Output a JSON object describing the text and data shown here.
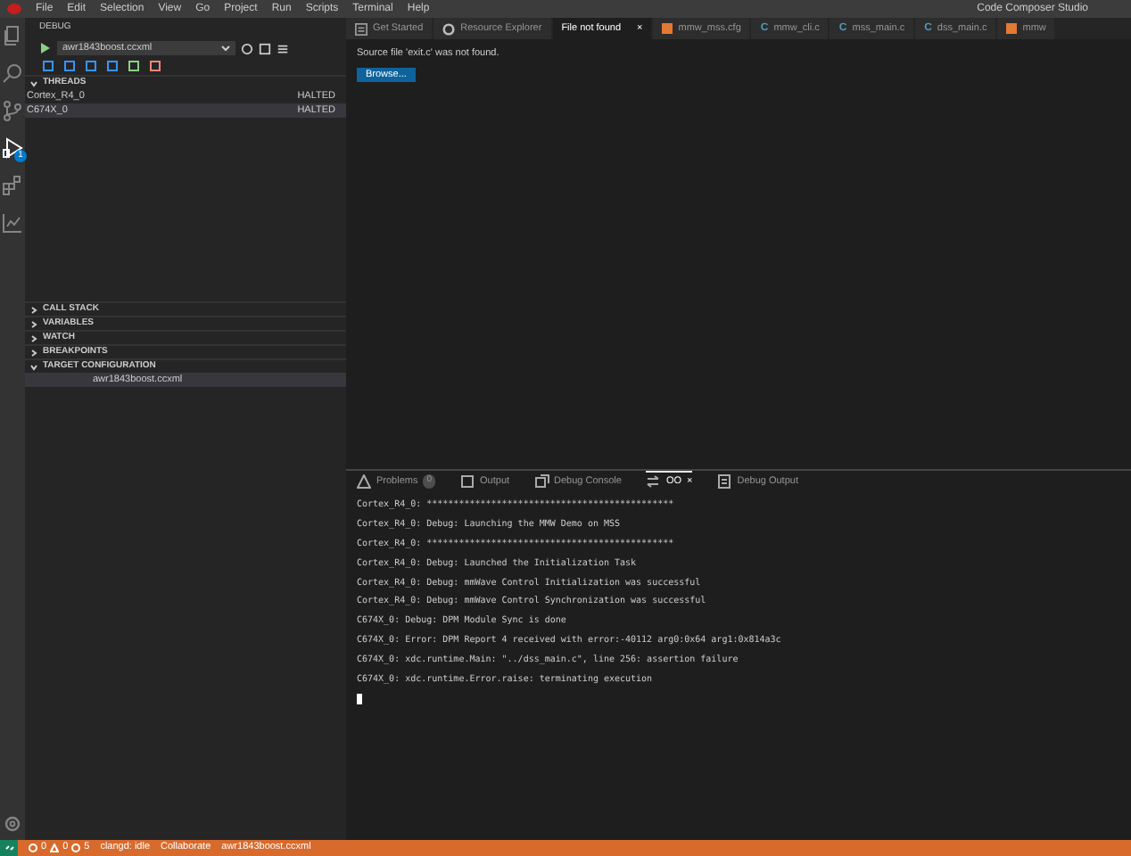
{
  "menu": [
    "File",
    "Edit",
    "Selection",
    "View",
    "Go",
    "Project",
    "Run",
    "Scripts",
    "Terminal",
    "Help"
  ],
  "window": {
    "title": "Code Composer Studio"
  },
  "activity_bar": [
    {
      "kind": "files",
      "selected": false
    },
    {
      "kind": "search",
      "selected": false
    },
    {
      "kind": "source",
      "selected": false
    },
    {
      "kind": "debug",
      "selected": true,
      "badge": "1"
    },
    {
      "kind": "extensions",
      "selected": false
    },
    {
      "kind": "chart",
      "selected": false
    }
  ],
  "sidebar": {
    "title": "DEBUG",
    "config": "awr1843boost.ccxml",
    "sections": [
      {
        "title": "THREADS",
        "expanded": true,
        "rows": [
          {
            "name": "Cortex_R4_0",
            "status": "HALTED",
            "selected": false
          },
          {
            "name": "C674X_0",
            "status": "HALTED",
            "selected": true
          }
        ]
      },
      {
        "title": "CALL STACK",
        "expanded": false
      },
      {
        "title": "VARIABLES",
        "expanded": false
      },
      {
        "title": "WATCH",
        "expanded": false
      },
      {
        "title": "BREAKPOINTS",
        "expanded": false
      },
      {
        "title": "TARGET CONFIGURATION",
        "expanded": true,
        "rows": [
          {
            "name": "awr1843boost.ccxml",
            "selected": true
          }
        ]
      }
    ]
  },
  "tabs": [
    {
      "label": "Get Started",
      "kind": "page",
      "selected": false
    },
    {
      "label": "Resource Explorer",
      "kind": "explorer",
      "selected": false
    },
    {
      "label": "File not found",
      "kind": "plain",
      "selected": true,
      "close": "×"
    },
    {
      "label": "mmw_mss.cfg",
      "kind": "cfg",
      "selected": false
    },
    {
      "label": "mmw_cli.c",
      "kind": "c",
      "glyph": "C",
      "selected": false
    },
    {
      "label": "mss_main.c",
      "kind": "c",
      "glyph": "C",
      "selected": false
    },
    {
      "label": "dss_main.c",
      "kind": "c",
      "glyph": "C",
      "selected": false
    },
    {
      "label": "mmw",
      "kind": "cfg",
      "selected": false
    }
  ],
  "editor": {
    "message": "Source file 'exit.c' was not found.",
    "button": "Browse..."
  },
  "panel": {
    "tabs": [
      {
        "label": "Problems",
        "kind": "problems",
        "badge": "0",
        "selected": false
      },
      {
        "label": "Output",
        "kind": "output",
        "selected": false
      },
      {
        "label": "Debug Console",
        "kind": "console",
        "selected": false
      },
      {
        "label": "OO",
        "kind": "io",
        "selected": true,
        "close": "×"
      },
      {
        "label": "Debug Output",
        "kind": "debug",
        "selected": false
      }
    ],
    "lines": [
      "Cortex_R4_0: **********************************************",
      "Cortex_R4_0: Debug: Launching the MMW Demo on MSS",
      "Cortex_R4_0: **********************************************",
      "Cortex_R4_0: Debug: Launched the Initialization Task",
      "Cortex_R4_0: Debug: mmWave Control Initialization was successful",
      "Cortex_R4_0: Debug: mmWave Control Synchronization was successful",
      "C674X_0: Debug: DPM Module Sync is done",
      "C674X_0: Error: DPM Report 4 received with error:-40112 arg0:0x64 arg1:0x814a3c",
      "C674X_0: xdc.runtime.Main: \"../dss_main.c\", line 256: assertion failure",
      "C674X_0: xdc.runtime.Error.raise: terminating execution"
    ]
  },
  "status_bar": {
    "errors": "0",
    "warnings": "0",
    "info": "5",
    "items": [
      "clangd: idle",
      "Collaborate",
      "awr1843boost.ccxml"
    ]
  }
}
